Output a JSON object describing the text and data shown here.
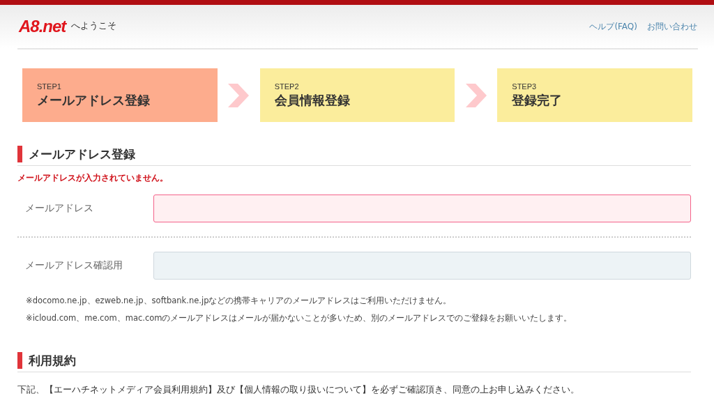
{
  "header": {
    "logo": "A8.net",
    "welcome": "へようこそ",
    "links": [
      "ヘルプ(FAQ)",
      "お問い合わせ"
    ]
  },
  "steps": [
    {
      "number": "STEP1",
      "label": "メールアドレス登録",
      "selected": true
    },
    {
      "number": "STEP2",
      "label": "会員情報登録",
      "selected": false
    },
    {
      "number": "STEP3",
      "label": "登録完了",
      "selected": false
    }
  ],
  "sections": [
    {
      "kind": "form",
      "title": "メールアドレス登録",
      "error": "メールアドレスが入力されていません。",
      "fields": [
        {
          "label": "メールアドレス",
          "invalid": true
        },
        {
          "label": "メールアドレス確認用",
          "invalid": false
        }
      ],
      "notes": [
        "※docomo.ne.jp、ezweb.ne.jp、softbank.ne.jpなどの携帯キャリアのメールアドレスはご利用いただけません。",
        "※icloud.com、me.com、mac.comのメールアドレスはメールが届かないことが多いため、別のメールアドレスでのご登録をお願いいたします。"
      ]
    },
    {
      "kind": "text",
      "title": "利用規約",
      "text": "下記、【エーハチネットメディア会員利用規約】及び【個人情報の取り扱いについて】を必ずご確認頂き、同意の上お申し込みください。"
    }
  ]
}
